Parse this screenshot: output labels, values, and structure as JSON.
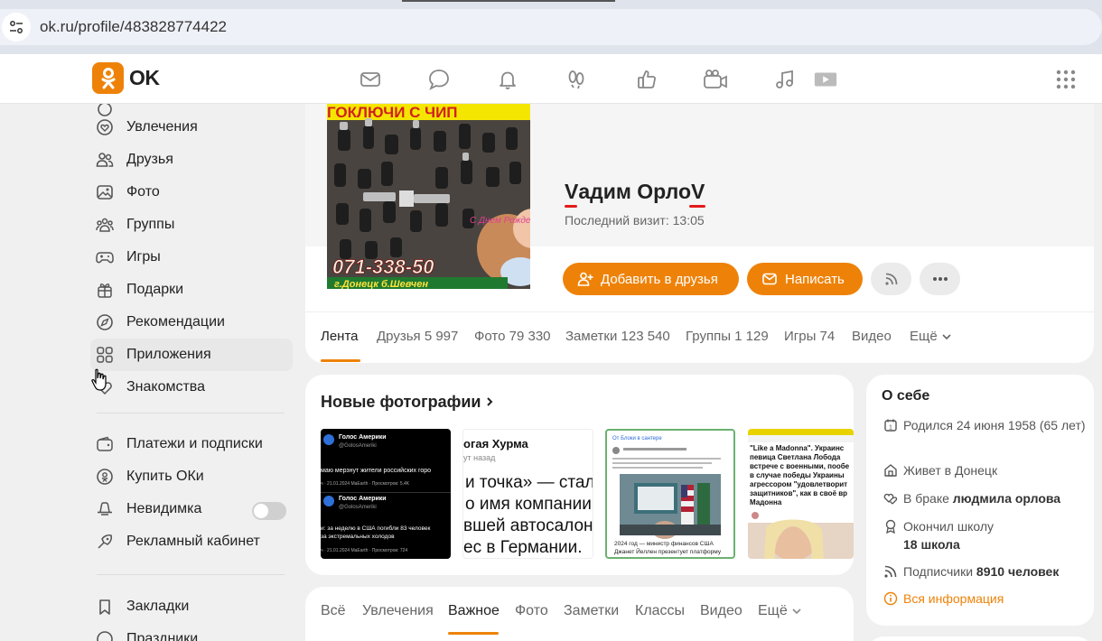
{
  "browser": {
    "url": "ok.ru/profile/483828774422"
  },
  "header": {
    "logo_text": "OK",
    "brand_color": "#ee8208",
    "nav_icons": [
      "mail-icon",
      "chat-icon",
      "bell-icon",
      "guests-icon",
      "like-icon",
      "video-chat-icon",
      "music-icon",
      "video-icon"
    ],
    "apps_icon": "grid-icon"
  },
  "sidebar": {
    "items": [
      {
        "label": "Увлечения",
        "icon": "hobby-icon"
      },
      {
        "label": "Друзья",
        "icon": "friends-icon"
      },
      {
        "label": "Фото",
        "icon": "photo-icon"
      },
      {
        "label": "Группы",
        "icon": "groups-icon"
      },
      {
        "label": "Игры",
        "icon": "gamepad-icon"
      },
      {
        "label": "Подарки",
        "icon": "gift-icon"
      },
      {
        "label": "Рекомендации",
        "icon": "compass-icon"
      },
      {
        "label": "Приложения",
        "icon": "apps-icon"
      },
      {
        "label": "Знакомства",
        "icon": "dating-icon"
      },
      {
        "label": "Платежи и подписки",
        "icon": "wallet-icon"
      },
      {
        "label": "Купить ОКи",
        "icon": "ok-coin-icon"
      },
      {
        "label": "Невидимка",
        "icon": "invisible-icon"
      },
      {
        "label": "Рекламный кабинет",
        "icon": "ads-icon"
      },
      {
        "label": "Закладки",
        "icon": "bookmark-icon"
      },
      {
        "label": "Праздники",
        "icon": "holidays-icon"
      }
    ],
    "invisible_toggle_on": false
  },
  "profile": {
    "name": "Vадим ОрлоV",
    "last_visit": "Последний визит: 13:05",
    "avatar_text_top": "ГОКЛЮЧИ С ЧИП",
    "avatar_phone": "071-338-50",
    "avatar_address": "г.Донецк б.Шевчен",
    "avatar_greeting": "С Днем Рождения!",
    "add_friend": "Добавить в друзья",
    "write": "Написать",
    "tabs": [
      {
        "label": "Лента"
      },
      {
        "label": "Друзья 5 997"
      },
      {
        "label": "Фото 79 330"
      },
      {
        "label": "Заметки 123 540"
      },
      {
        "label": "Группы 1 129"
      },
      {
        "label": "Игры 74"
      },
      {
        "label": "Видео"
      },
      {
        "label": "Ещё"
      }
    ]
  },
  "new_photos": {
    "title": "Новые фотографии",
    "thumb1": {
      "line1": "Голос Америки",
      "line2": "@GolosAmeriki",
      "line3": "маю мерзнут жители российских горо",
      "line4": "ч · 21.01.2024 MaEarth · Просмотров: 5,4K",
      "line5": "Голос Америки",
      "line6": "@GolosAmeriki",
      "line7": "и: за неделю в США погибли 83 человек",
      "line8": "за экстремальных холодов",
      "line9": "ч · 21.01.2024 MaEarth · Просмотров: 724"
    },
    "thumb2": {
      "line1": "огая Хурма",
      "line2": "ут назад",
      "line3": "и точка» — стал",
      "line4": "о имя компании",
      "line5": "вшей автосалон",
      "line6": "ес в Германии."
    },
    "thumb3": {
      "line1": "От Блоки в сантере",
      "line2": "2024 год — министр финансов США",
      "line3": "Джанет Йеллен презентует платформу"
    },
    "thumb4": {
      "line1": "\"Like a Madonna\". Украинс",
      "line2": "певица Светлана Лобода",
      "line3": "встрече с военными, пообе",
      "line4": "в случае победы Украины",
      "line5": "агрессором \"удовлетворит",
      "line6": "защитников\", как в своё вр",
      "line7": "Мадонна"
    }
  },
  "feed": {
    "tabs": [
      {
        "label": "Всё"
      },
      {
        "label": "Увлечения"
      },
      {
        "label": "Важное"
      },
      {
        "label": "Фото"
      },
      {
        "label": "Заметки"
      },
      {
        "label": "Классы"
      },
      {
        "label": "Видео"
      },
      {
        "label": "Ещё"
      }
    ]
  },
  "about": {
    "title": "О себе",
    "born": "Родился 24 июня 1958 (65 лет)",
    "lives_prefix": "Живет в ",
    "lives_city": "Донецк",
    "married_prefix": "В браке ",
    "married_name": "людмила орлова",
    "school_prefix": "Окончил школу",
    "school_name": "18 школа",
    "subs_prefix": "Подписчики ",
    "subs_count": "8910 человек",
    "all_info": "Вся информация"
  }
}
